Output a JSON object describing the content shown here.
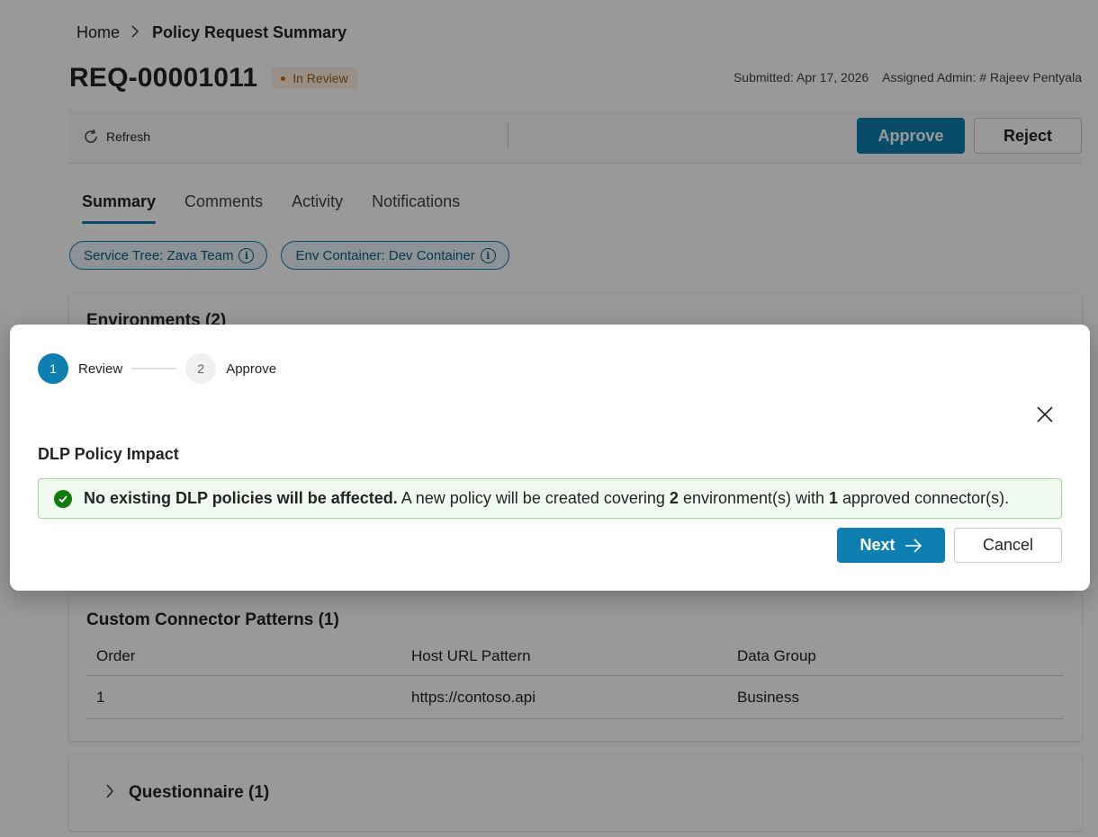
{
  "breadcrumb": {
    "home": "Home",
    "current": "Policy Request Summary"
  },
  "request": {
    "id": "REQ-00001011",
    "status": "In Review",
    "submitted": "Submitted: Apr 17, 2026",
    "assigned_admin": "Assigned Admin: # Rajeev Pentyala"
  },
  "toolbar": {
    "refresh": "Refresh",
    "approve": "Approve",
    "reject": "Reject"
  },
  "tabs": [
    {
      "label": "Summary",
      "active": true
    },
    {
      "label": "Comments",
      "active": false
    },
    {
      "label": "Activity",
      "active": false
    },
    {
      "label": "Notifications",
      "active": false
    }
  ],
  "pills": [
    {
      "label": "Service Tree: Zava Team"
    },
    {
      "label": "Env Container: Dev Container"
    }
  ],
  "environments": {
    "title": "Environments (2)"
  },
  "custom_connectors": {
    "title": "Custom Connector Patterns (1)",
    "columns": [
      "Order",
      "Host URL Pattern",
      "Data Group"
    ],
    "rows": [
      [
        "1",
        "https://contoso.api",
        "Business"
      ]
    ]
  },
  "questionnaire": {
    "title": "Questionnaire (1)"
  },
  "dialog": {
    "steps": [
      {
        "number": "1",
        "label": "Review",
        "active": true
      },
      {
        "number": "2",
        "label": "Approve",
        "active": false
      }
    ],
    "heading": "DLP Policy Impact",
    "message": {
      "bold": "No existing DLP policies will be affected.",
      "part1": " A new policy will be created covering ",
      "env_count": "2",
      "part2": " environment(s) with ",
      "connector_count": "1",
      "part3": " approved connector(s)."
    },
    "next": "Next",
    "cancel": "Cancel"
  },
  "colors": {
    "accent": "#0e7fb0",
    "success": "#107c10",
    "warning": "#c26b16"
  },
  "icons": [
    "chevron-right-icon",
    "refresh-icon",
    "info-icon",
    "checkmark-circle-icon",
    "close-icon",
    "arrow-right-icon"
  ]
}
